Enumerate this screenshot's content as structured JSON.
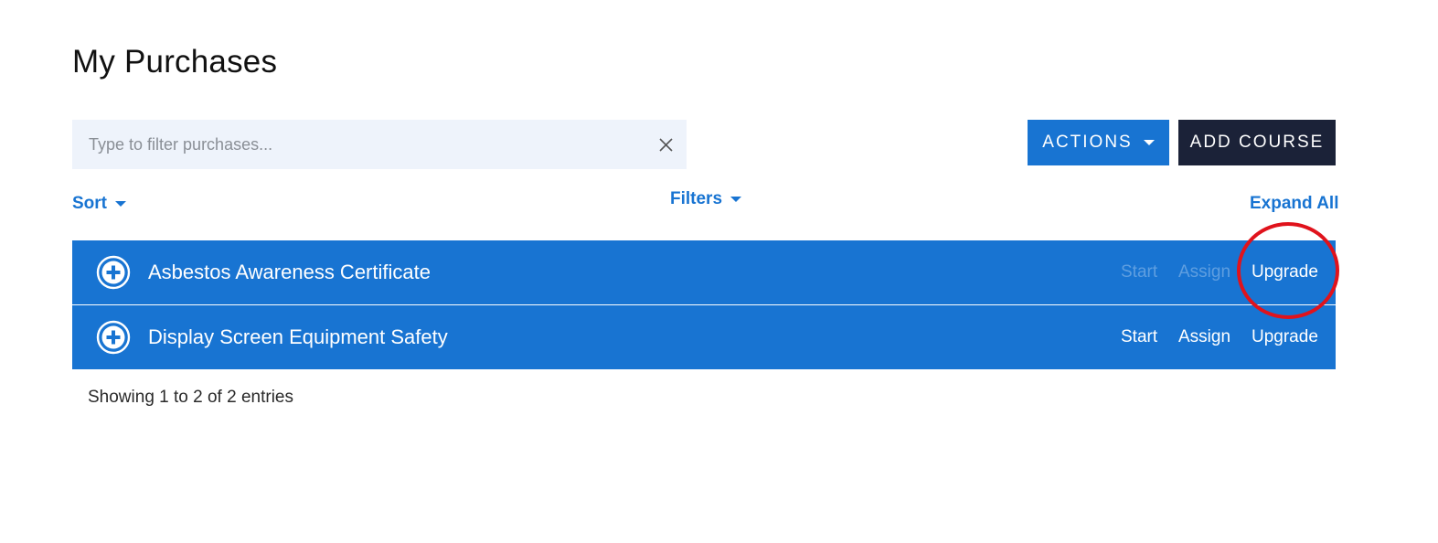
{
  "page": {
    "title": "My Purchases"
  },
  "search": {
    "placeholder": "Type to filter purchases...",
    "value": ""
  },
  "toolbar": {
    "actions_label": "ACTIONS",
    "add_course_label": "ADD COURSE"
  },
  "controls": {
    "sort_label": "Sort",
    "filters_label": "Filters",
    "expand_all_label": "Expand All"
  },
  "purchases": [
    {
      "title": "Asbestos Awareness Certificate",
      "start": "Start",
      "assign": "Assign",
      "upgrade": "Upgrade",
      "start_enabled": false,
      "assign_enabled": false
    },
    {
      "title": "Display Screen Equipment Safety",
      "start": "Start",
      "assign": "Assign",
      "upgrade": "Upgrade",
      "start_enabled": true,
      "assign_enabled": true
    }
  ],
  "footer": {
    "entries_info": "Showing 1 to 2 of 2 entries"
  },
  "colors": {
    "primary": "#1874d2",
    "dark_button": "#1b2238",
    "search_bg": "#eef3fb",
    "annotation": "#e0131c"
  },
  "icons": {
    "clear": "close-icon",
    "row_expand": "plus-circle-icon",
    "dropdown": "caret-down-icon"
  }
}
